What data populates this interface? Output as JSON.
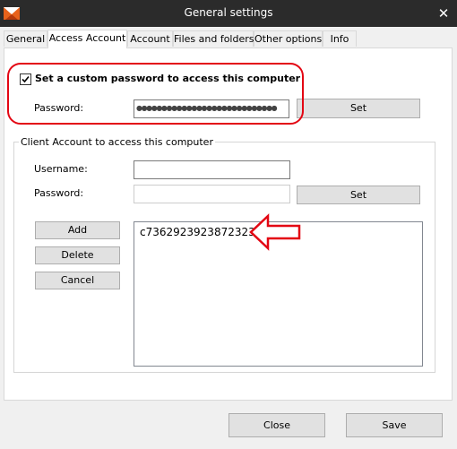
{
  "window": {
    "title": "General settings",
    "close_glyph": "✕"
  },
  "tabs": [
    {
      "label": "General"
    },
    {
      "label": "Access Account"
    },
    {
      "label": "Account"
    },
    {
      "label": "Files and folders"
    },
    {
      "label": "Other options"
    },
    {
      "label": "Info"
    }
  ],
  "custom_password": {
    "checkbox_label": "Set a custom password to access this computer",
    "checked": true,
    "password_label": "Password:",
    "password_value": "●●●●●●●●●●●●●●●●●●●●●●●●●●●●",
    "set_label": "Set"
  },
  "client_account": {
    "group_label": "Client Account to access this computer",
    "username_label": "Username:",
    "username_value": "",
    "password_label": "Password:",
    "password_value": "",
    "set_label": "Set",
    "add_label": "Add",
    "delete_label": "Delete",
    "cancel_label": "Cancel",
    "accounts": [
      "c7362923923872323"
    ]
  },
  "footer": {
    "close_label": "Close",
    "save_label": "Save"
  },
  "colors": {
    "titlebar": "#2b2b2b",
    "annotation": "#e30613",
    "logo": "#e8621b"
  },
  "icons": [
    "app-logo-icon",
    "close-icon",
    "checkmark-icon",
    "annotation-arrow-icon"
  ]
}
